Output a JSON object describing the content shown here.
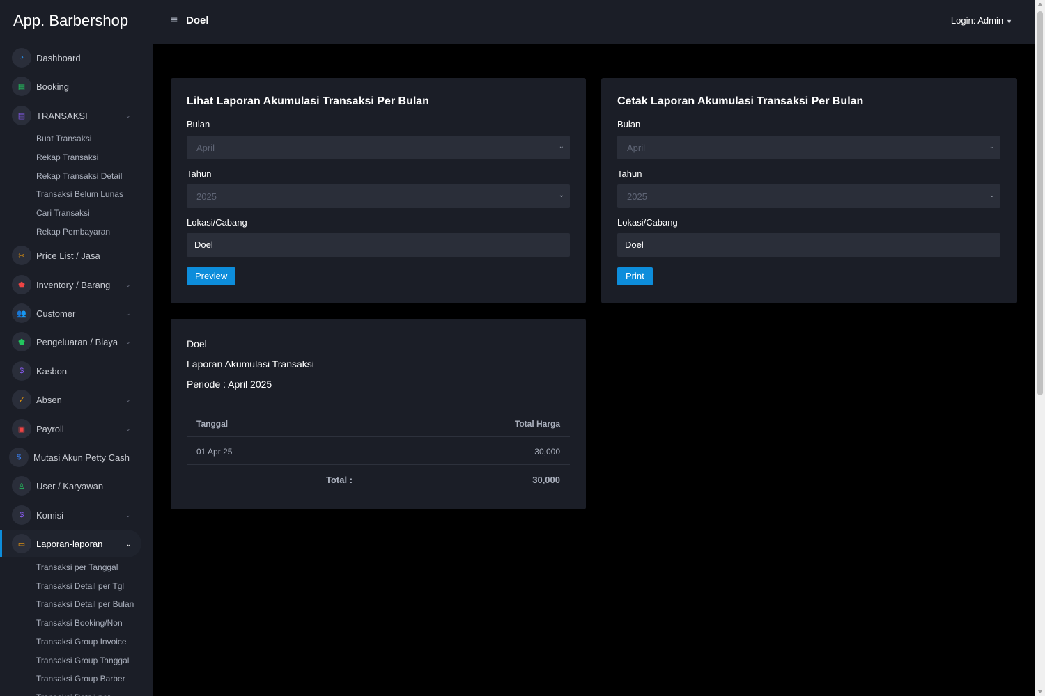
{
  "app": {
    "brand": "App. Barbershop",
    "location": "Doel",
    "login": "Login: Admin"
  },
  "sidebar": {
    "items": [
      {
        "label": "Dashboard",
        "icon": "dashboard-icon",
        "color": "#2b8ee6"
      },
      {
        "label": "Booking",
        "icon": "booking-icon",
        "color": "#22c55e"
      },
      {
        "label": "TRANSAKSI",
        "icon": "transaksi-icon",
        "color": "#8b5cf6"
      },
      {
        "label": "Price List / Jasa",
        "icon": "scissors-icon",
        "color": "#f59e0b"
      },
      {
        "label": "Inventory / Barang",
        "icon": "shield-icon",
        "color": "#ef4444"
      },
      {
        "label": "Customer",
        "icon": "users-icon",
        "color": "#3b82f6"
      },
      {
        "label": "Pengeluaran / Biaya",
        "icon": "shield-check-icon",
        "color": "#22c55e"
      },
      {
        "label": "Kasbon",
        "icon": "money-icon",
        "color": "#8b5cf6"
      },
      {
        "label": "Absen",
        "icon": "check-icon",
        "color": "#f59e0b"
      },
      {
        "label": "Payroll",
        "icon": "payroll-icon",
        "color": "#ef4444"
      },
      {
        "label": "Mutasi Akun Petty Cash",
        "icon": "money-icon",
        "color": "#3b82f6"
      },
      {
        "label": "User / Karyawan",
        "icon": "user-icon",
        "color": "#22c55e"
      },
      {
        "label": "Komisi",
        "icon": "money-icon",
        "color": "#8b5cf6"
      },
      {
        "label": "Laporan-laporan",
        "icon": "laptop-icon",
        "color": "#f59e0b"
      }
    ],
    "transaksi_sub": [
      "Buat Transaksi",
      "Rekap Transaksi",
      "Rekap Transaksi Detail",
      "Transaksi Belum Lunas",
      "Cari Transaksi",
      "Rekap Pembayaran"
    ],
    "laporan_sub": [
      "Transaksi per Tanggal",
      "Transaksi Detail per Tgl",
      "Transaksi Detail per Bulan",
      "Transaksi Booking/Non",
      "Transaksi Group Invoice",
      "Transaksi Group Tanggal",
      "Transaksi Group Barber",
      "Transaksi Detail per..."
    ]
  },
  "view_card": {
    "title": "Lihat Laporan Akumulasi Transaksi Per Bulan",
    "bulan_label": "Bulan",
    "bulan_value": "April",
    "tahun_label": "Tahun",
    "tahun_value": "2025",
    "lokasi_label": "Lokasi/Cabang",
    "lokasi_value": "Doel",
    "button": "Preview"
  },
  "print_card": {
    "title": "Cetak Laporan Akumulasi Transaksi Per Bulan",
    "bulan_label": "Bulan",
    "bulan_value": "April",
    "tahun_label": "Tahun",
    "tahun_value": "2025",
    "lokasi_label": "Lokasi/Cabang",
    "lokasi_value": "Doel",
    "button": "Print"
  },
  "report": {
    "location": "Doel",
    "title": "Laporan Akumulasi Transaksi",
    "period": "Periode : April 2025",
    "columns": [
      "Tanggal",
      "Total Harga"
    ],
    "rows": [
      {
        "date": "01 Apr 25",
        "total": "30,000"
      }
    ],
    "total_label": "Total :",
    "total_value": "30,000"
  }
}
